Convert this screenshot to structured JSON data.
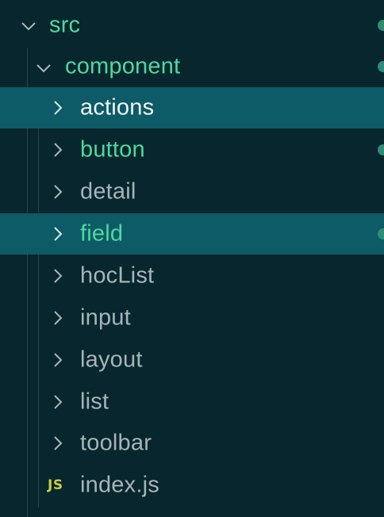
{
  "colors": {
    "background": "#07262d",
    "selected_row": "#0d5b66",
    "modified_text": "#4ed8a0",
    "normal_text": "#a7b4b8",
    "selected_text": "#f2f7f8",
    "chevron": "#aab6ba",
    "modified_dot": "#2f8c76",
    "js_icon": "#cbcb41"
  },
  "tree": {
    "root": {
      "label": "src",
      "expanded": true,
      "modified": true
    },
    "component": {
      "label": "component",
      "expanded": true,
      "modified": true
    },
    "children": [
      {
        "label": "actions",
        "type": "folder",
        "modified": false,
        "selected": true
      },
      {
        "label": "button",
        "type": "folder",
        "modified": true,
        "selected": false
      },
      {
        "label": "detail",
        "type": "folder",
        "modified": false,
        "selected": false
      },
      {
        "label": "field",
        "type": "folder",
        "modified": true,
        "selected": true
      },
      {
        "label": "hocList",
        "type": "folder",
        "modified": false,
        "selected": false
      },
      {
        "label": "input",
        "type": "folder",
        "modified": false,
        "selected": false
      },
      {
        "label": "layout",
        "type": "folder",
        "modified": false,
        "selected": false
      },
      {
        "label": "list",
        "type": "folder",
        "modified": false,
        "selected": false
      },
      {
        "label": "toolbar",
        "type": "folder",
        "modified": false,
        "selected": false
      },
      {
        "label": "index.js",
        "type": "file",
        "icon": "JS",
        "modified": false,
        "selected": false
      }
    ]
  }
}
